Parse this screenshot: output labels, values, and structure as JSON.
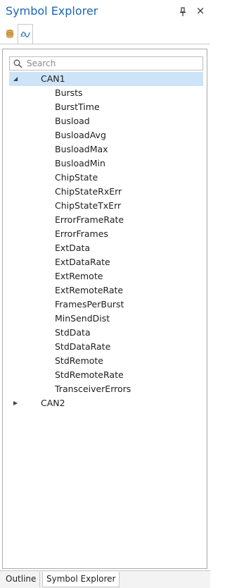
{
  "panel": {
    "title": "Symbol Explorer",
    "icons": {
      "pin": "pin-icon",
      "close": "close-icon",
      "close_glyph": "×"
    }
  },
  "mini_tabs": [
    {
      "icon": "database-icon",
      "active": false
    },
    {
      "icon": "symbol-wave-icon",
      "active": true
    }
  ],
  "search": {
    "placeholder": "Search",
    "value": ""
  },
  "tree": {
    "nodes": [
      {
        "label": "CAN1",
        "expanded": true,
        "selected": true,
        "children": [
          "Bursts",
          "BurstTime",
          "Busload",
          "BusloadAvg",
          "BusloadMax",
          "BusloadMin",
          "ChipState",
          "ChipStateRxErr",
          "ChipStateTxErr",
          "ErrorFrameRate",
          "ErrorFrames",
          "ExtData",
          "ExtDataRate",
          "ExtRemote",
          "ExtRemoteRate",
          "FramesPerBurst",
          "MinSendDist",
          "StdData",
          "StdDataRate",
          "StdRemote",
          "StdRemoteRate",
          "TransceiverErrors"
        ]
      },
      {
        "label": "CAN2",
        "expanded": false,
        "selected": false,
        "children": []
      }
    ]
  },
  "bottom_tabs": [
    {
      "label": "Outline",
      "active": false
    },
    {
      "label": "Symbol Explorer",
      "active": true
    }
  ],
  "colors": {
    "title": "#1a66b8",
    "selection": "#cde3f7",
    "db_icon": "#c9953f",
    "wave_icon": "#2a7fc9"
  }
}
